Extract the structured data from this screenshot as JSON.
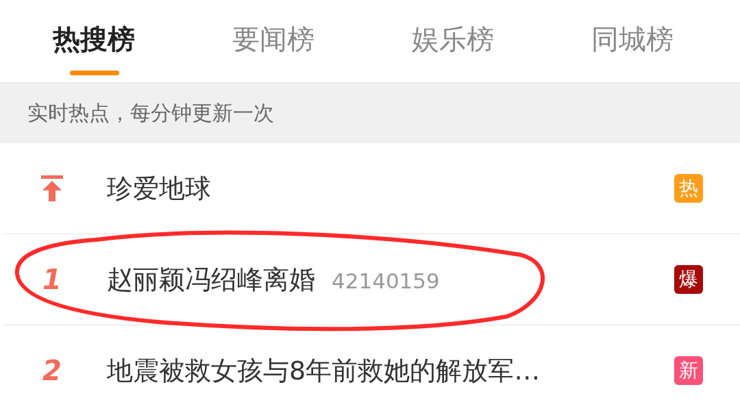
{
  "tabs": [
    {
      "label": "热搜榜",
      "selected": true
    },
    {
      "label": "要闻榜",
      "selected": false
    },
    {
      "label": "娱乐榜",
      "selected": false
    },
    {
      "label": "同城榜",
      "selected": false
    }
  ],
  "notice": "实时热点，每分钟更新一次",
  "items": [
    {
      "kind": "pinned",
      "title": "珍爱地球",
      "badge": "热",
      "color": "#ff9d1b"
    },
    {
      "kind": "ranked",
      "rank": "1",
      "title": "赵丽颖冯绍峰离婚",
      "count": "42140159",
      "badge": "爆",
      "color": "#a80a0a"
    },
    {
      "kind": "ranked",
      "rank": "2",
      "title": "地震被救女孩与8年前救她的解放军…",
      "badge": "新",
      "color": "#fa5179"
    }
  ]
}
